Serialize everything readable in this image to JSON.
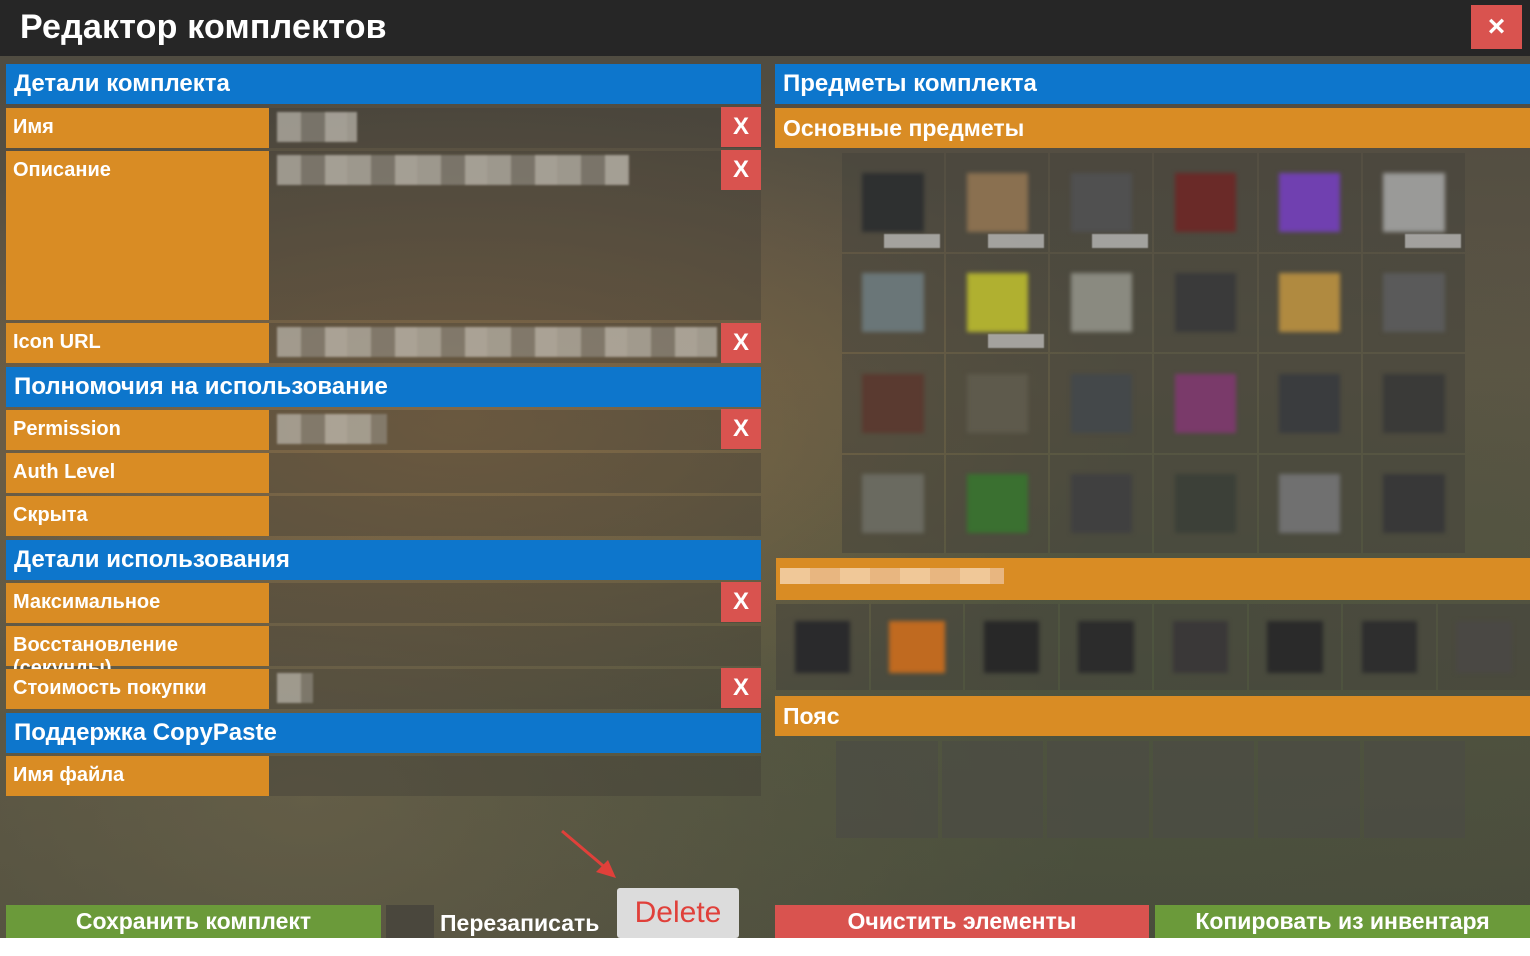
{
  "window": {
    "title": "Редактор комплектов",
    "close_label": "×"
  },
  "left": {
    "kit_details": {
      "header": "Детали комплекта",
      "name_label": "Имя",
      "description_label": "Описание",
      "icon_url_label": "Icon URL"
    },
    "permissions": {
      "header": "Полномочия на использование",
      "permission_label": "Permission",
      "auth_level_label": "Auth Level",
      "hidden_label": "Скрыта"
    },
    "usage": {
      "header": "Детали использования",
      "max_label": "Максимальное",
      "cooldown_label": "Восстановление (секунды)",
      "cost_label": "Стоимость покупки"
    },
    "copypaste": {
      "header": "Поддержка CopyPaste",
      "filename_label": "Имя файла"
    },
    "clear_label": "X"
  },
  "right": {
    "items_header": "Предметы комплекта",
    "main_header": "Основные предметы",
    "belt_header": "Пояс",
    "main_progress": 0.3
  },
  "bottom": {
    "save_label": "Сохранить комплект",
    "overwrite_label": "Перезаписать",
    "delete_label": "Delete",
    "clear_items_label": "Очистить элементы",
    "copy_inventory_label": "Копировать из инвентаря"
  },
  "colors": {
    "blue_header": "#0d76cc",
    "orange": "#d98c24",
    "red": "#d9534f",
    "green": "#6b9a3a",
    "title_bar": "#262626"
  }
}
